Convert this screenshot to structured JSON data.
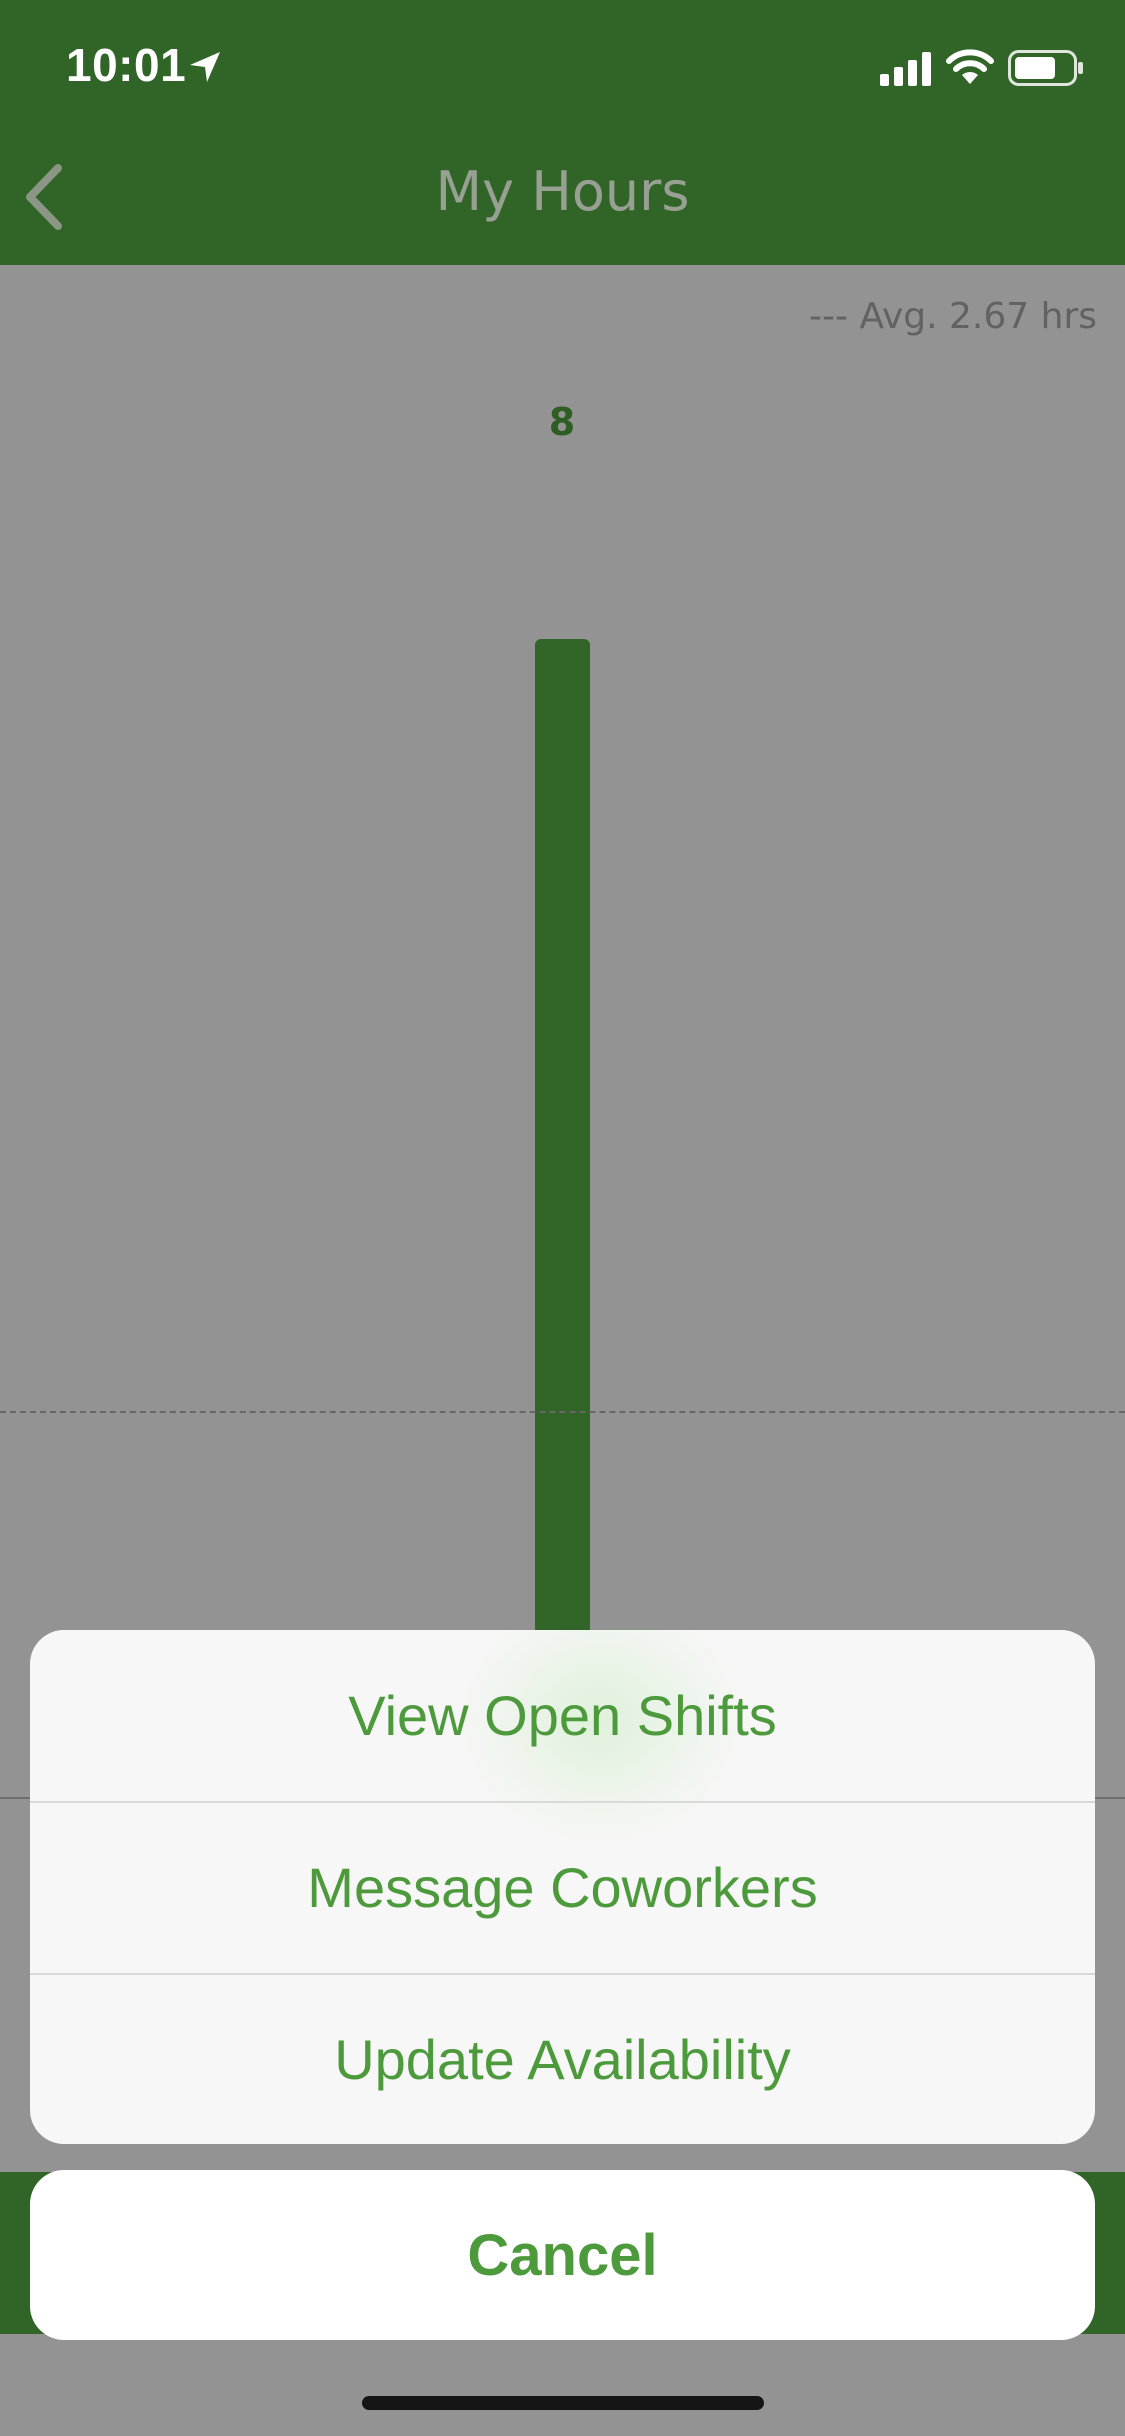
{
  "status_bar": {
    "time": "10:01"
  },
  "nav": {
    "title": "My Hours"
  },
  "chart_data": {
    "type": "bar",
    "categories": [
      ""
    ],
    "values": [
      8
    ],
    "average_label": "--- Avg. 2.67 hrs",
    "average_value": 2.67,
    "ylim": [
      0,
      9.1
    ],
    "bar_color": "#326628"
  },
  "action_sheet": {
    "items": [
      {
        "label": "View Open Shifts"
      },
      {
        "label": "Message Coworkers"
      },
      {
        "label": "Update Availability"
      }
    ],
    "cancel_label": "Cancel"
  },
  "colors": {
    "header": "#316528",
    "accent": "#4d9a3c",
    "overlay": "#939393"
  }
}
